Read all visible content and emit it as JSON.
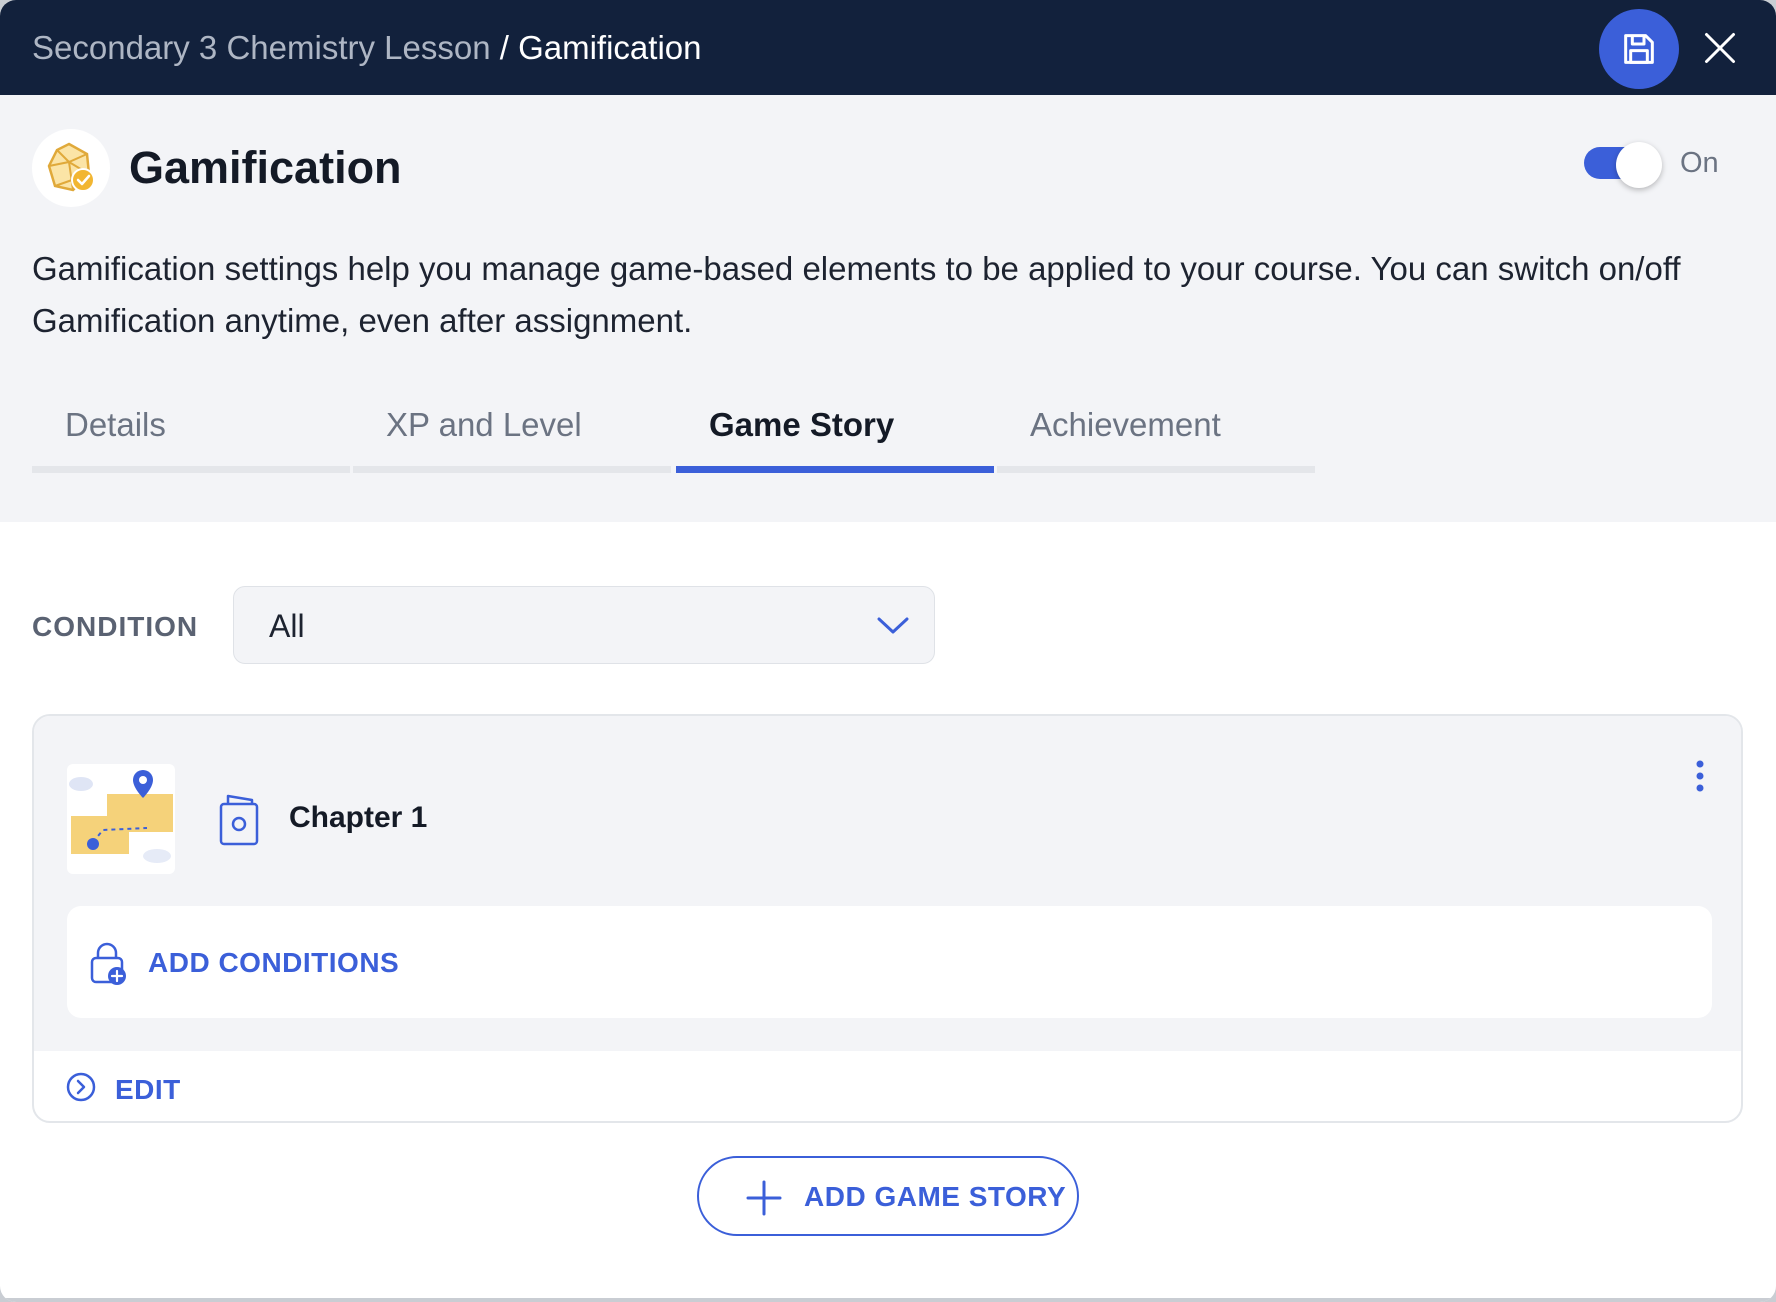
{
  "window": {
    "breadcrumb": {
      "parent": "Secondary 3 Chemistry Lesson",
      "separator": "/",
      "current": "Gamification"
    },
    "save_icon": "save-icon",
    "close_icon": "close-icon"
  },
  "header": {
    "logo_icon": "gamification-badge-icon",
    "title": "Gamification",
    "toggle": {
      "state": true,
      "label": "On"
    },
    "description": "Gamification settings help you manage game-based elements to be applied to your course. You can switch on/off Gamification anytime, even after assignment."
  },
  "tabs": [
    {
      "label": "Details",
      "active": false
    },
    {
      "label": "XP and Level",
      "active": false
    },
    {
      "label": "Game Story",
      "active": true
    },
    {
      "label": "Achievement",
      "active": false
    }
  ],
  "filter": {
    "label": "CONDITION",
    "selected": "All"
  },
  "stories": [
    {
      "title": "Chapter 1",
      "add_conditions_label": "ADD CONDITIONS",
      "edit_label": "EDIT"
    }
  ],
  "add_story_label": "ADD GAME STORY",
  "colors": {
    "topbar": "#12213c",
    "accent": "#3b5fd9",
    "panel": "#f3f4f7",
    "badge": "#f2b632"
  }
}
